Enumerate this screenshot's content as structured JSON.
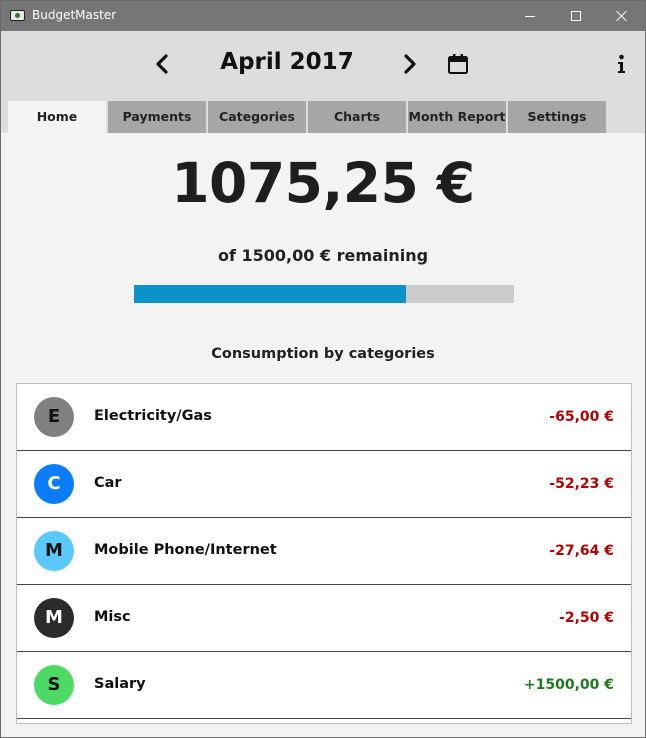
{
  "window": {
    "title": "BudgetMaster",
    "icon": "app-icon",
    "controls": [
      "minimize-icon",
      "maximize-icon",
      "close-icon"
    ]
  },
  "header": {
    "month": "April 2017",
    "prev_icon": "chevron-left-icon",
    "next_icon": "chevron-right-icon",
    "calendar_icon": "calendar-icon",
    "info_icon": "info-icon"
  },
  "tabs": [
    {
      "label": "Home",
      "active": true
    },
    {
      "label": "Payments",
      "active": false
    },
    {
      "label": "Categories",
      "active": false
    },
    {
      "label": "Charts",
      "active": false
    },
    {
      "label": "Month Report",
      "active": false
    },
    {
      "label": "Settings",
      "active": false
    }
  ],
  "home": {
    "remaining_amount": "1075,25 €",
    "remaining_text": "of 1500,00 € remaining",
    "progress_fraction": 0.717,
    "consumption_title": "Consumption by categories"
  },
  "categories": [
    {
      "letter": "E",
      "name": "Electricity/Gas",
      "amount": "-65,00 €",
      "color": "#808080",
      "letter_color": "#111111",
      "positive": false
    },
    {
      "letter": "C",
      "name": "Car",
      "amount": "-52,23 €",
      "color": "#0b7dfa",
      "letter_color": "#ffffff",
      "positive": false
    },
    {
      "letter": "M",
      "name": "Mobile Phone/Internet",
      "amount": "-27,64 €",
      "color": "#5ac8fa",
      "letter_color": "#111111",
      "positive": false
    },
    {
      "letter": "M",
      "name": "Misc",
      "amount": "-2,50 €",
      "color": "#2b2b2b",
      "letter_color": "#ffffff",
      "positive": false
    },
    {
      "letter": "S",
      "name": "Salary",
      "amount": "+1500,00 €",
      "color": "#4cd964",
      "letter_color": "#111111",
      "positive": true
    }
  ],
  "colors": {
    "progress_fill": "#0a93c9",
    "negative": "#b40000",
    "positive": "#1f7a1f"
  }
}
